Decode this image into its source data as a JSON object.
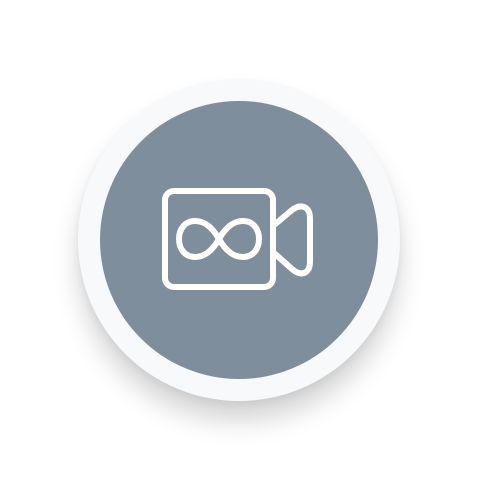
{
  "app_icon": {
    "icon": "infinity-video-camera-icon",
    "colors": {
      "ring": "#f7f9fb",
      "disc": "#7f8e9d",
      "glyph": "#ffffff"
    }
  }
}
